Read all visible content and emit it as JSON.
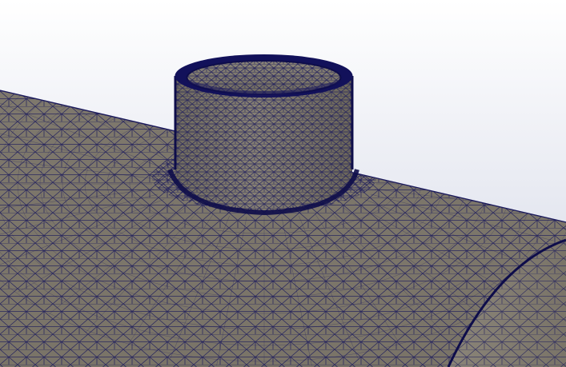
{
  "viewport": {
    "background_top": "#ffffff",
    "background_bottom": "#d3d7e6"
  },
  "model": {
    "surface_color": "#7d776b",
    "surface_light": "#8d877b",
    "surface_dark": "#5f5a50",
    "mesh_color": "#1b1a5c",
    "mesh_dense_color": "#0e0d4a"
  }
}
